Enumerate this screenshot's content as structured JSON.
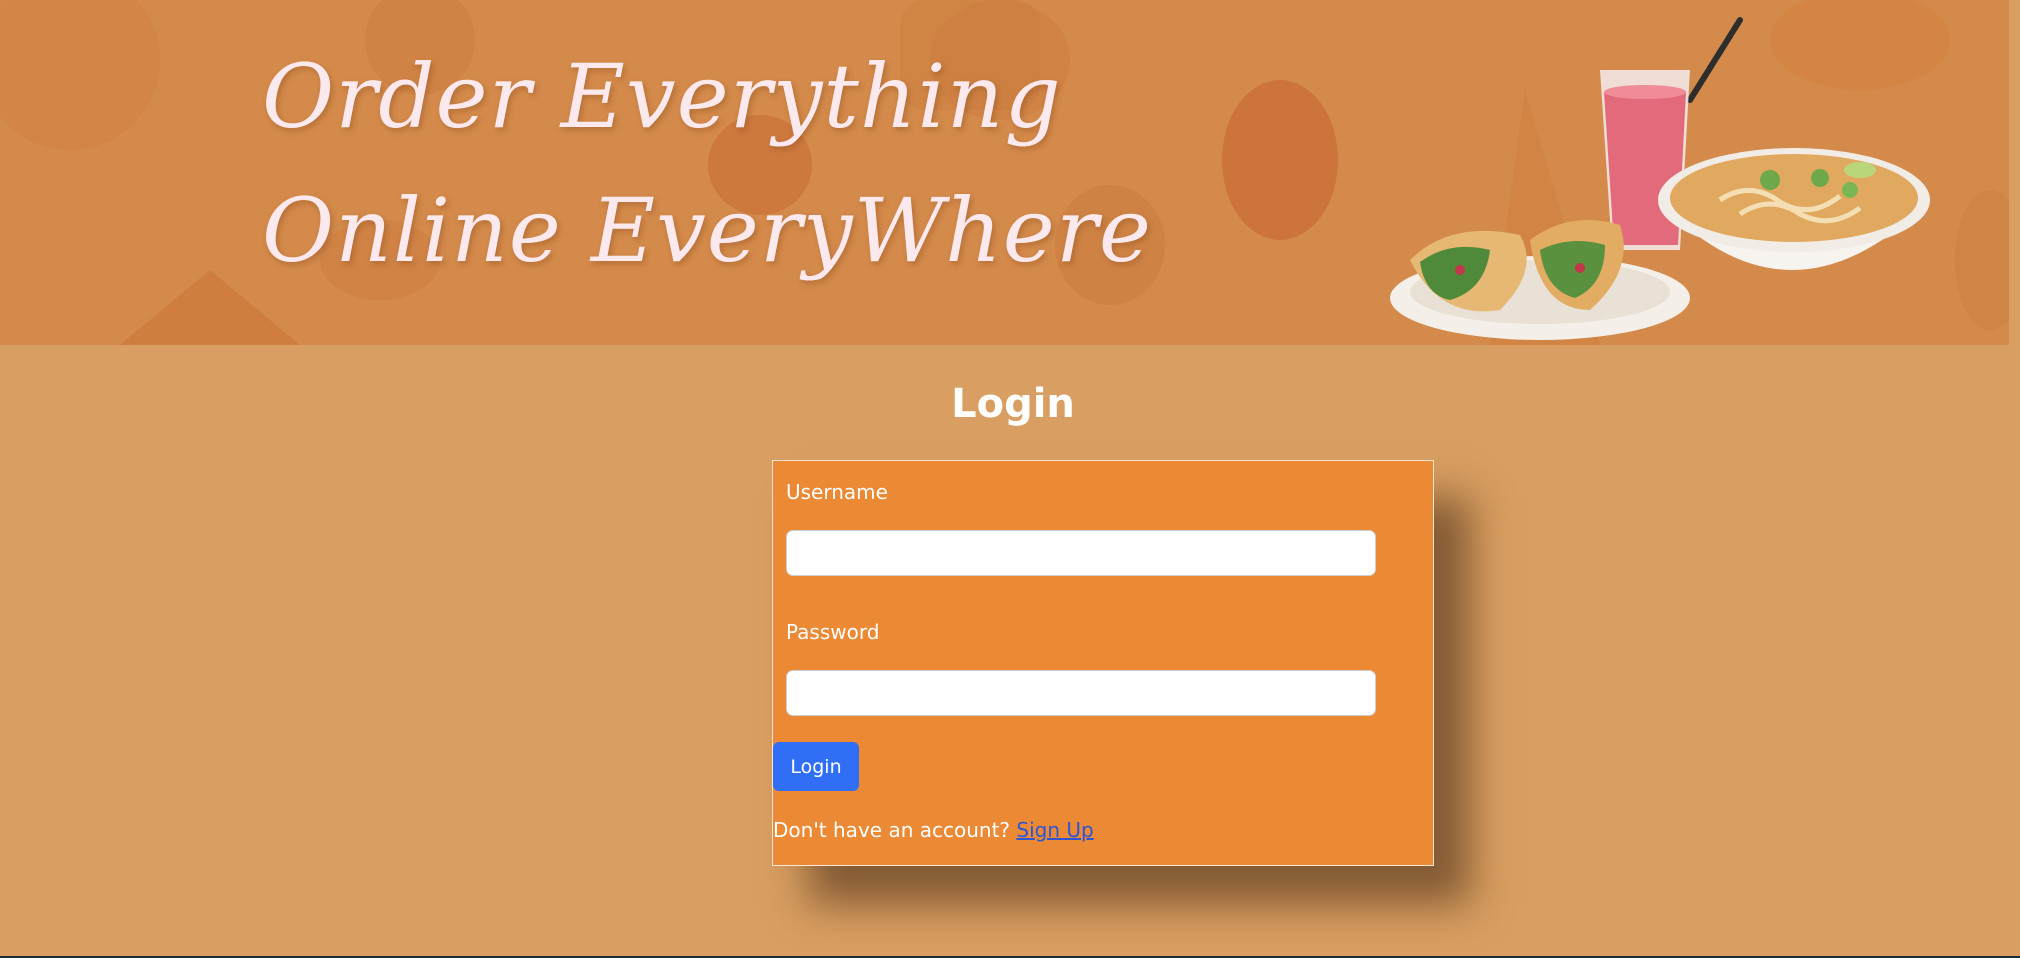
{
  "banner": {
    "headline_line1": "Order Everything",
    "headline_line2": "Online EveryWhere"
  },
  "page_title": "Login",
  "form": {
    "username_label": "Username",
    "username_value": "",
    "password_label": "Password",
    "password_value": "",
    "submit_label": "Login",
    "signup_prompt": "Don't have an account?",
    "signup_link": "Sign Up"
  },
  "colors": {
    "page_background": "#d99e61",
    "card_background": "#ec8935",
    "button": "#2f6ef5",
    "link": "#2d55d6"
  },
  "icons": [
    "burrito-plate-icon",
    "smoothie-glass-icon",
    "noodle-bowl-icon"
  ]
}
